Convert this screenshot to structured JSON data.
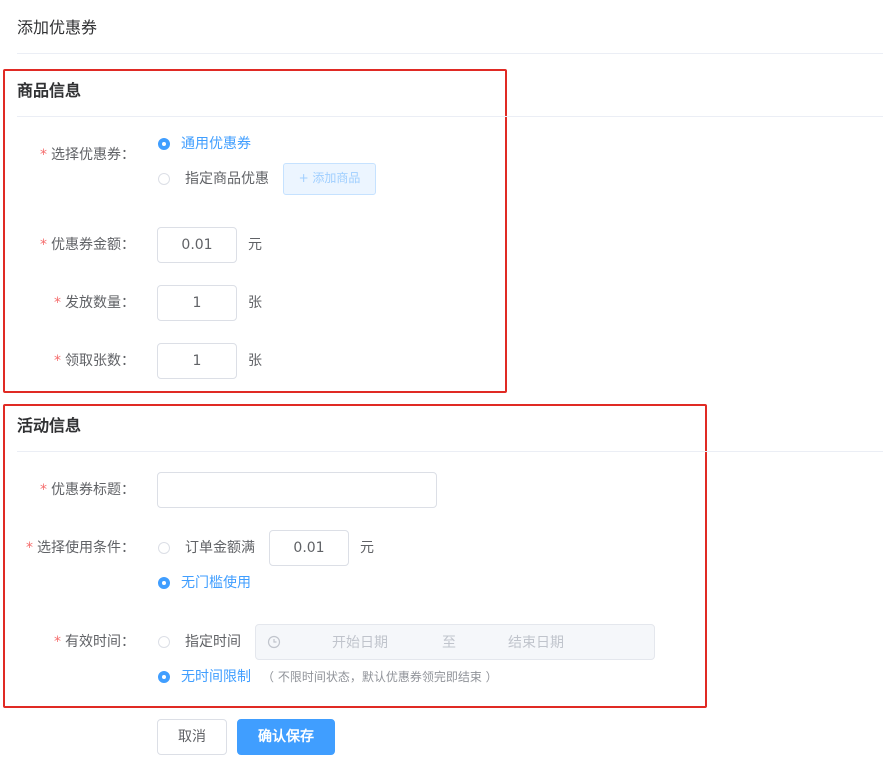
{
  "page": {
    "title": "添加优惠券"
  },
  "goods_section": {
    "title": "商品信息",
    "coupon_type": {
      "label": "选择优惠券：",
      "option_general": "通用优惠券",
      "option_specific": "指定商品优惠",
      "add_goods_button": "+ 添加商品",
      "selected": "通用优惠券"
    },
    "amount": {
      "label": "优惠券金额：",
      "value": "0.01",
      "unit": "元"
    },
    "issue_qty": {
      "label": "发放数量：",
      "value": "1",
      "unit": "张"
    },
    "claim_limit": {
      "label": "领取张数：",
      "value": "1",
      "unit": "张"
    }
  },
  "activity_section": {
    "title": "活动信息",
    "coupon_title": {
      "label": "优惠券标题：",
      "value": ""
    },
    "condition": {
      "label": "选择使用条件：",
      "option_min": "订单金额满",
      "min_value": "0.01",
      "unit": "元",
      "option_none": "无门槛使用",
      "selected": "无门槛使用"
    },
    "validity": {
      "label": "有效时间：",
      "option_range": "指定时间",
      "start_placeholder": "开始日期",
      "separator": "至",
      "end_placeholder": "结束日期",
      "option_unlimited": "无时间限制",
      "note": "（ 不限时间状态，默认优惠券领完即结束 ）",
      "selected": "无时间限制"
    }
  },
  "actions": {
    "cancel": "取消",
    "save": "确认保存"
  },
  "colors": {
    "primary": "#409eff",
    "required": "#f56c6c",
    "highlight": "#e02a24"
  }
}
